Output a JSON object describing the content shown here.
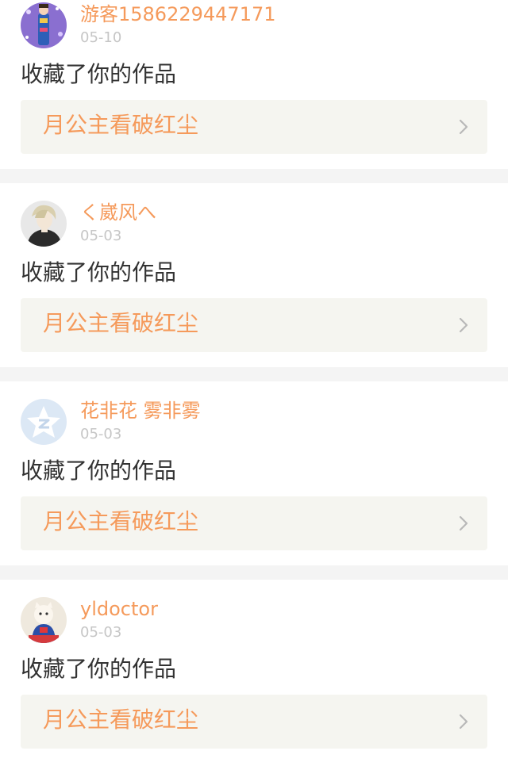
{
  "notifications": [
    {
      "username": "游客1586229447171",
      "date": "05-10",
      "action": "收藏了你的作品",
      "work_title": "月公主看破红尘",
      "avatar_icon": "costume-figure-avatar"
    },
    {
      "username": "く崴风へ",
      "date": "05-03",
      "action": "收藏了你的作品",
      "work_title": "月公主看破红尘",
      "avatar_icon": "anime-boy-avatar"
    },
    {
      "username": "花非花 雾非雾",
      "date": "05-03",
      "action": "收藏了你的作品",
      "work_title": "月公主看破红尘",
      "avatar_icon": "qzone-default-avatar"
    },
    {
      "username": "yldoctor",
      "date": "05-03",
      "action": "收藏了你的作品",
      "work_title": "月公主看破红尘",
      "avatar_icon": "cat-costume-avatar"
    }
  ],
  "colors": {
    "accent": "#f59a5b",
    "date": "#c6c6c6",
    "text": "#333333",
    "link_bg": "#f5f5f0",
    "separator": "#f4f4f4"
  }
}
